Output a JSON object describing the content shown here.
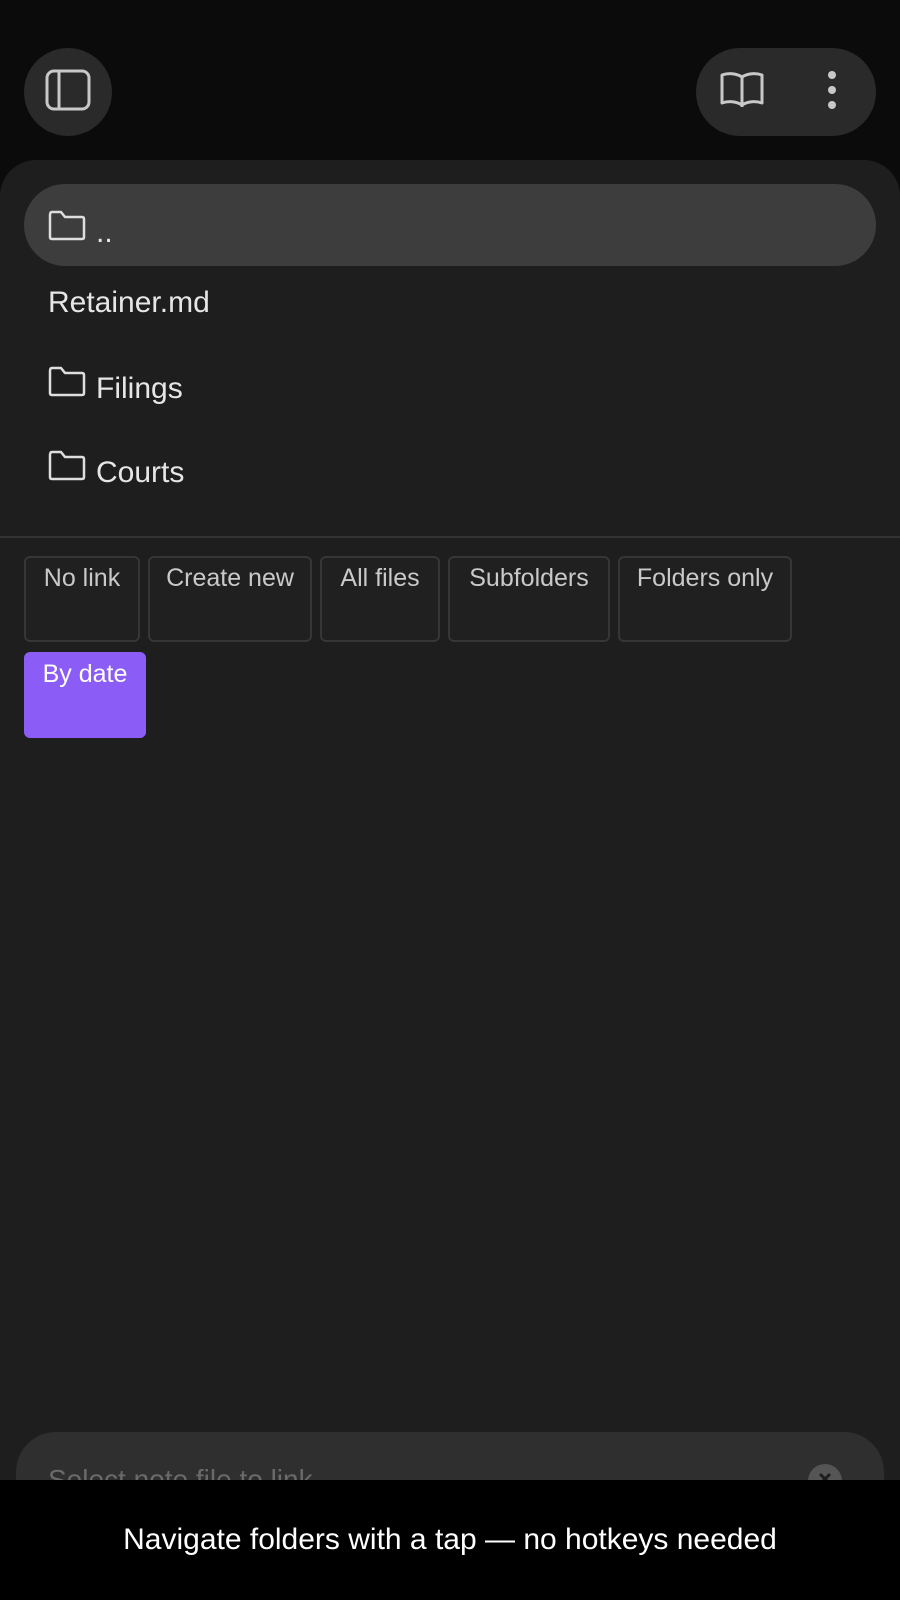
{
  "topbar": {
    "sidebar_toggle_icon": "sidebar-toggle-icon",
    "reader_icon": "book-open-icon",
    "more_icon": "more-vertical-icon"
  },
  "file_list": {
    "items": [
      {
        "type": "folder",
        "label": "..",
        "icon": "folder-icon",
        "highlighted": true
      },
      {
        "type": "file",
        "label": "Retainer.md"
      },
      {
        "type": "folder",
        "label": "Filings",
        "icon": "folder-icon"
      },
      {
        "type": "folder",
        "label": "Courts",
        "icon": "folder-icon"
      }
    ]
  },
  "options": {
    "chips": [
      {
        "label": "No link",
        "style": "outline"
      },
      {
        "label": "Create new",
        "style": "outline"
      },
      {
        "label": "All files",
        "style": "outline"
      },
      {
        "label": "Subfolders",
        "style": "outline"
      },
      {
        "label": "Folders only",
        "style": "outline"
      },
      {
        "label": "By date",
        "style": "primary"
      }
    ]
  },
  "search": {
    "placeholder": "Select note file to link",
    "clear_icon": "clear-icon"
  },
  "caption": {
    "text": "Navigate folders with a tap — no hotkeys needed"
  },
  "colors": {
    "accent": "#8b5cf6",
    "sheet_background": "#1e1e1e",
    "highlight_row": "#3d3d3d"
  }
}
